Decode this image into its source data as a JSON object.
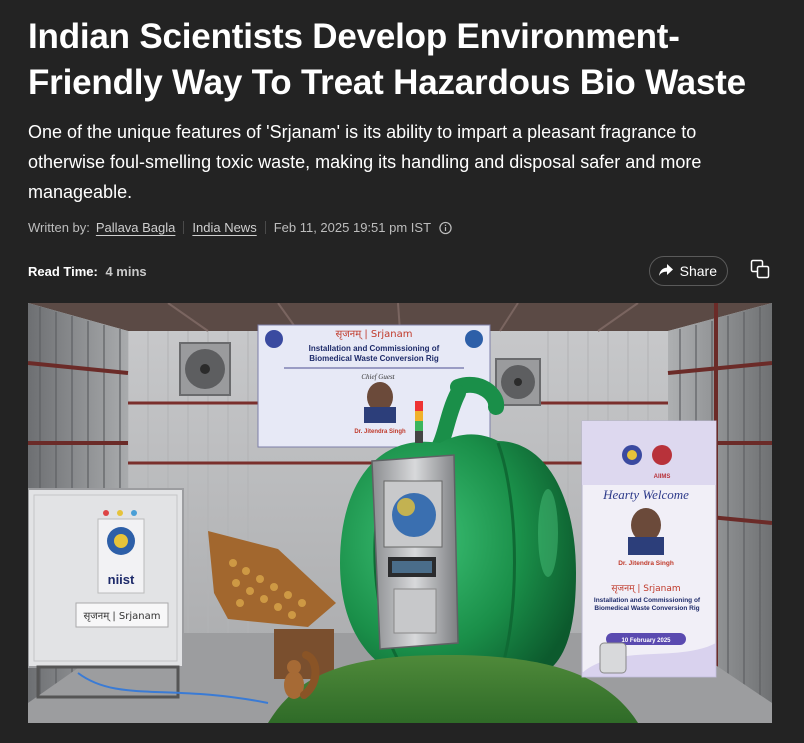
{
  "article": {
    "headline": "Indian Scientists Develop Environment-Friendly Way To Treat Hazardous Bio Waste",
    "summary": "One of the unique features of 'Srjanam' is its ability to impart a pleasant fragrance to otherwise foul-smelling toxic waste, making its handling and disposal safer and more manageable.",
    "byline": {
      "label": "Written by:",
      "author": "Pallava Bagla",
      "category": "India News",
      "timestamp": "Feb 11, 2025 19:51 pm IST"
    },
    "read_time": {
      "label": "Read Time:",
      "value": "4 mins"
    },
    "actions": {
      "share_label": "Share"
    }
  },
  "hero_image": {
    "banner_top": {
      "hindi": "सृजनम् | Srjanam",
      "title_line1": "Installation and Commissioning of",
      "title_line2": "Biomedical Waste Conversion Rig",
      "guest": "Chief Guest",
      "person": "Dr. Jitendra Singh"
    },
    "standee": {
      "logo_right": "AIIMS",
      "welcome": "Hearty Welcome",
      "person": "Dr. Jitendra Singh",
      "hindi": "सृजनम् | Srjanam",
      "title": "Installation and Commissioning of Biomedical Waste Conversion Rig",
      "date": "10 February 2025"
    },
    "machine_label": "सृजनम् | Srjanam",
    "machine_brand": "niist"
  },
  "colors": {
    "background": "#232323",
    "text": "#ffffff",
    "muted": "#bdbdbd",
    "pepper_green": "#1f9a52"
  }
}
